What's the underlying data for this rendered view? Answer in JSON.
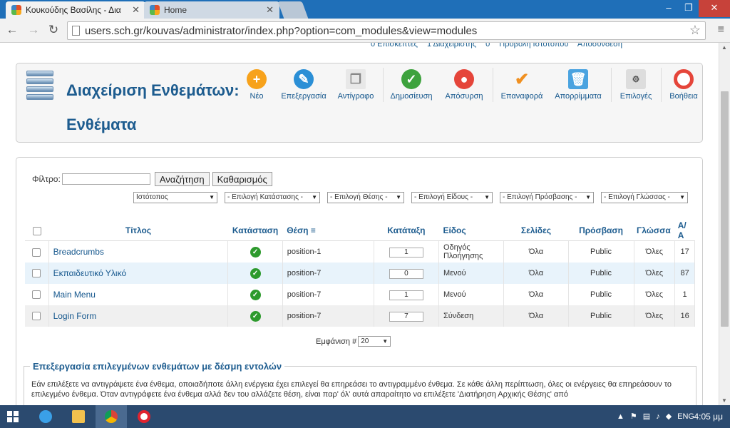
{
  "browser": {
    "tabs": [
      {
        "title": "Κουκούδης Βασίλης - Δια",
        "active": true
      },
      {
        "title": "Home",
        "active": false
      }
    ],
    "url": "users.sch.gr/kouvas/administrator/index.php?option=com_modules&view=modules"
  },
  "status": {
    "visitors": "0 Επισκέπτες",
    "admins": "1 Διαχειριστής",
    "messages": "0",
    "view_site": "Προβολή Ιστοτόπου",
    "logout": "Αποσύνδεση"
  },
  "header": {
    "title": "Διαχείριση Ενθεμάτων: Ενθέματα"
  },
  "toolbar": {
    "new": "Νέο",
    "edit": "Επεξεργασία",
    "copy": "Αντίγραφο",
    "publish": "Δημοσίευση",
    "unpublish": "Απόσυρση",
    "checkin": "Επαναφορά",
    "trash": "Απορρίμματα",
    "options": "Επιλογές",
    "help": "Βοήθεια"
  },
  "filters": {
    "label": "Φίλτρο:",
    "search_value": "",
    "search_button": "Αναζήτηση",
    "clear_button": "Καθαρισμός",
    "site": "Ιστότοπος",
    "state": "- Επιλογή Κατάστασης -",
    "position": "- Επιλογή Θέσης -",
    "type": "- Επιλογή Είδους -",
    "access": "- Επιλογή Πρόσβασης -",
    "language": "- Επιλογή Γλώσσας -"
  },
  "table": {
    "headers": {
      "title": "Τίτλος",
      "status": "Κατάσταση",
      "position": "Θέση",
      "ordering": "Κατάταξη",
      "type": "Είδος",
      "pages": "Σελίδες",
      "access": "Πρόσβαση",
      "language": "Γλώσσα",
      "id": "Α/Α"
    },
    "rows": [
      {
        "title": "Breadcrumbs",
        "position": "position-1",
        "ordering": "1",
        "type": "Οδηγός Πλοήγησης",
        "pages": "Όλα",
        "access": "Public",
        "language": "Όλες",
        "id": "17"
      },
      {
        "title": "Εκπαιδευτικό Υλικό",
        "position": "position-7",
        "ordering": "0",
        "type": "Μενού",
        "pages": "Όλα",
        "access": "Public",
        "language": "Όλες",
        "id": "87"
      },
      {
        "title": "Main Menu",
        "position": "position-7",
        "ordering": "1",
        "type": "Μενού",
        "pages": "Όλα",
        "access": "Public",
        "language": "Όλες",
        "id": "1"
      },
      {
        "title": "Login Form",
        "position": "position-7",
        "ordering": "7",
        "type": "Σύνδεση",
        "pages": "Όλα",
        "access": "Public",
        "language": "Όλες",
        "id": "16"
      }
    ]
  },
  "pager": {
    "label": "Εμφάνιση #",
    "value": "20"
  },
  "batch": {
    "legend": "Επεξεργασία επιλεγμένων ενθεμάτων με δέσμη εντολών",
    "text": "Εάν επιλέξετε να αντιγράψετε ένα ένθεμα, οποιαδήποτε άλλη ενέργεια έχει επιλεγεί θα επηρεάσει το αντιγραμμένο ένθεμα. Σε κάθε άλλη περίπτωση, όλες οι ενέργειες θα επηρεάσουν το επιλεγμένο ένθεμα. Όταν αντιγράφετε ένα ένθεμα αλλά δεν του αλλάζετε θέση, είναι παρ' όλ' αυτά απαραίτητο να επιλέξετε 'Διατήρηση Αρχικής Θέσης' από"
  },
  "taskbar": {
    "language": "ENG",
    "time": "4:05 μμ"
  },
  "colors": {
    "accent": "#1d5c8f",
    "published": "#2d9a2d",
    "selected_row": "#e8f3fb"
  }
}
